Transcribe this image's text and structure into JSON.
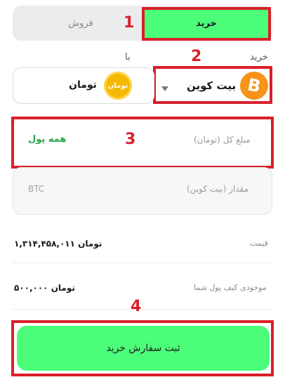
{
  "tabs": {
    "buy": "خرید",
    "sell": "فروش"
  },
  "markers": {
    "m1": "1",
    "m2": "2",
    "m3": "3",
    "m4": "4"
  },
  "pair": {
    "buy_label": "خرید",
    "with_label": "با",
    "coin_name": "بیت کوین",
    "coin_icon": "bitcoin-icon",
    "currency_name": "تومان",
    "currency_icon": "toman-coin-icon",
    "currency_icon_text": "تومان"
  },
  "total_field": {
    "placeholder": "مبلغ کل (تومان)",
    "all_money": "همه پول"
  },
  "amount_field": {
    "placeholder": "مقدار (بیت کوین)",
    "unit": "BTC"
  },
  "info": {
    "price_label": "قیمت",
    "price_value": "۱,۳۱۴,۴۵۸,۰۱۱ تومان",
    "balance_label": "موجودی کیف پول شما",
    "balance_value": "۵۰۰,۰۰۰ تومان"
  },
  "submit_label": "ثبت سفارش خرید",
  "colors": {
    "accent": "#4cfd7a",
    "annotation": "#d9202a",
    "bitcoin": "#f7931a",
    "toman": "#f5b800",
    "all_money": "#2aa84a"
  }
}
